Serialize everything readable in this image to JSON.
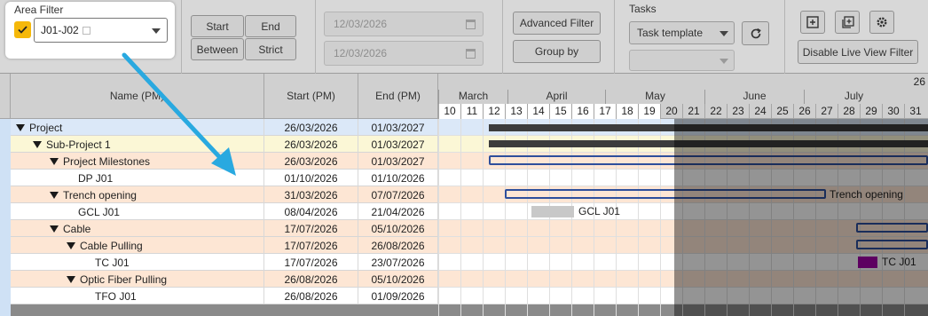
{
  "area_filter": {
    "label": "Area Filter",
    "value": "J01-J02",
    "checked": true,
    "accent": "#f5b80a"
  },
  "range_buttons": [
    "Start",
    "End",
    "Between",
    "Strict"
  ],
  "date_from": {
    "value": "12/03/2026"
  },
  "date_to": {
    "value": "12/03/2026"
  },
  "advanced_filter_label": "Advanced Filter",
  "group_by_label": "Group by",
  "tasks": {
    "label": "Tasks",
    "template_value": "Task template"
  },
  "icons": {
    "refresh": "refresh-icon",
    "add": "add-box-icon",
    "add_multiple": "add-multiple-icon",
    "settings": "gear-settings-icon"
  },
  "disable_live_label": "Disable Live View Filter",
  "columns": {
    "name": "Name (PM)",
    "start": "Start (PM)",
    "end": "End (PM)"
  },
  "year_label": "26",
  "months": [
    "March",
    "April",
    "May",
    "June",
    "July"
  ],
  "days": [
    "10",
    "11",
    "12",
    "13",
    "14",
    "15",
    "16",
    "17",
    "18",
    "19",
    "20",
    "21",
    "22",
    "23",
    "24",
    "25",
    "26",
    "27",
    "28",
    "29",
    "30",
    "31"
  ],
  "rows": [
    {
      "name": "Project",
      "start": "26/03/2026",
      "end": "01/03/2027",
      "level": 0,
      "group": true,
      "color": "#dbe8f8"
    },
    {
      "name": "Sub-Project 1",
      "start": "26/03/2026",
      "end": "01/03/2027",
      "level": 1,
      "group": true,
      "color": "#fbf7d6"
    },
    {
      "name": "Project Milestones",
      "start": "26/03/2026",
      "end": "01/03/2027",
      "level": 2,
      "group": true,
      "color": "#fde6d4"
    },
    {
      "name": "DP J01",
      "start": "01/10/2026",
      "end": "01/10/2026",
      "level": 3,
      "group": false,
      "color": "#ffffff"
    },
    {
      "name": "Trench opening",
      "start": "31/03/2026",
      "end": "07/07/2026",
      "level": 2,
      "group": true,
      "color": "#fde6d4"
    },
    {
      "name": "GCL J01",
      "start": "08/04/2026",
      "end": "21/04/2026",
      "level": 3,
      "group": false,
      "color": "#ffffff"
    },
    {
      "name": "Cable",
      "start": "17/07/2026",
      "end": "05/10/2026",
      "level": 2,
      "group": true,
      "color": "#fde6d4"
    },
    {
      "name": "Cable Pulling",
      "start": "17/07/2026",
      "end": "26/08/2026",
      "level": 3,
      "group": true,
      "color": "#fde6d4"
    },
    {
      "name": "TC J01",
      "start": "17/07/2026",
      "end": "23/07/2026",
      "level": 4,
      "group": false,
      "color": "#ffffff"
    },
    {
      "name": "Optic Fiber Pulling",
      "start": "26/08/2026",
      "end": "05/10/2026",
      "level": 3,
      "group": true,
      "color": "#fde6d4"
    },
    {
      "name": "TFO J01",
      "start": "26/08/2026",
      "end": "01/09/2026",
      "level": 4,
      "group": false,
      "color": "#ffffff"
    }
  ],
  "bar_labels": {
    "trench": "Trench opening",
    "gcl": "GCL J01",
    "tc": "TC J01"
  },
  "colors": {
    "bracket": "#2e4f9c",
    "summary": "#3c3c3c",
    "tc_task": "#a100a8",
    "gcl_task": "#c8c8c8"
  }
}
